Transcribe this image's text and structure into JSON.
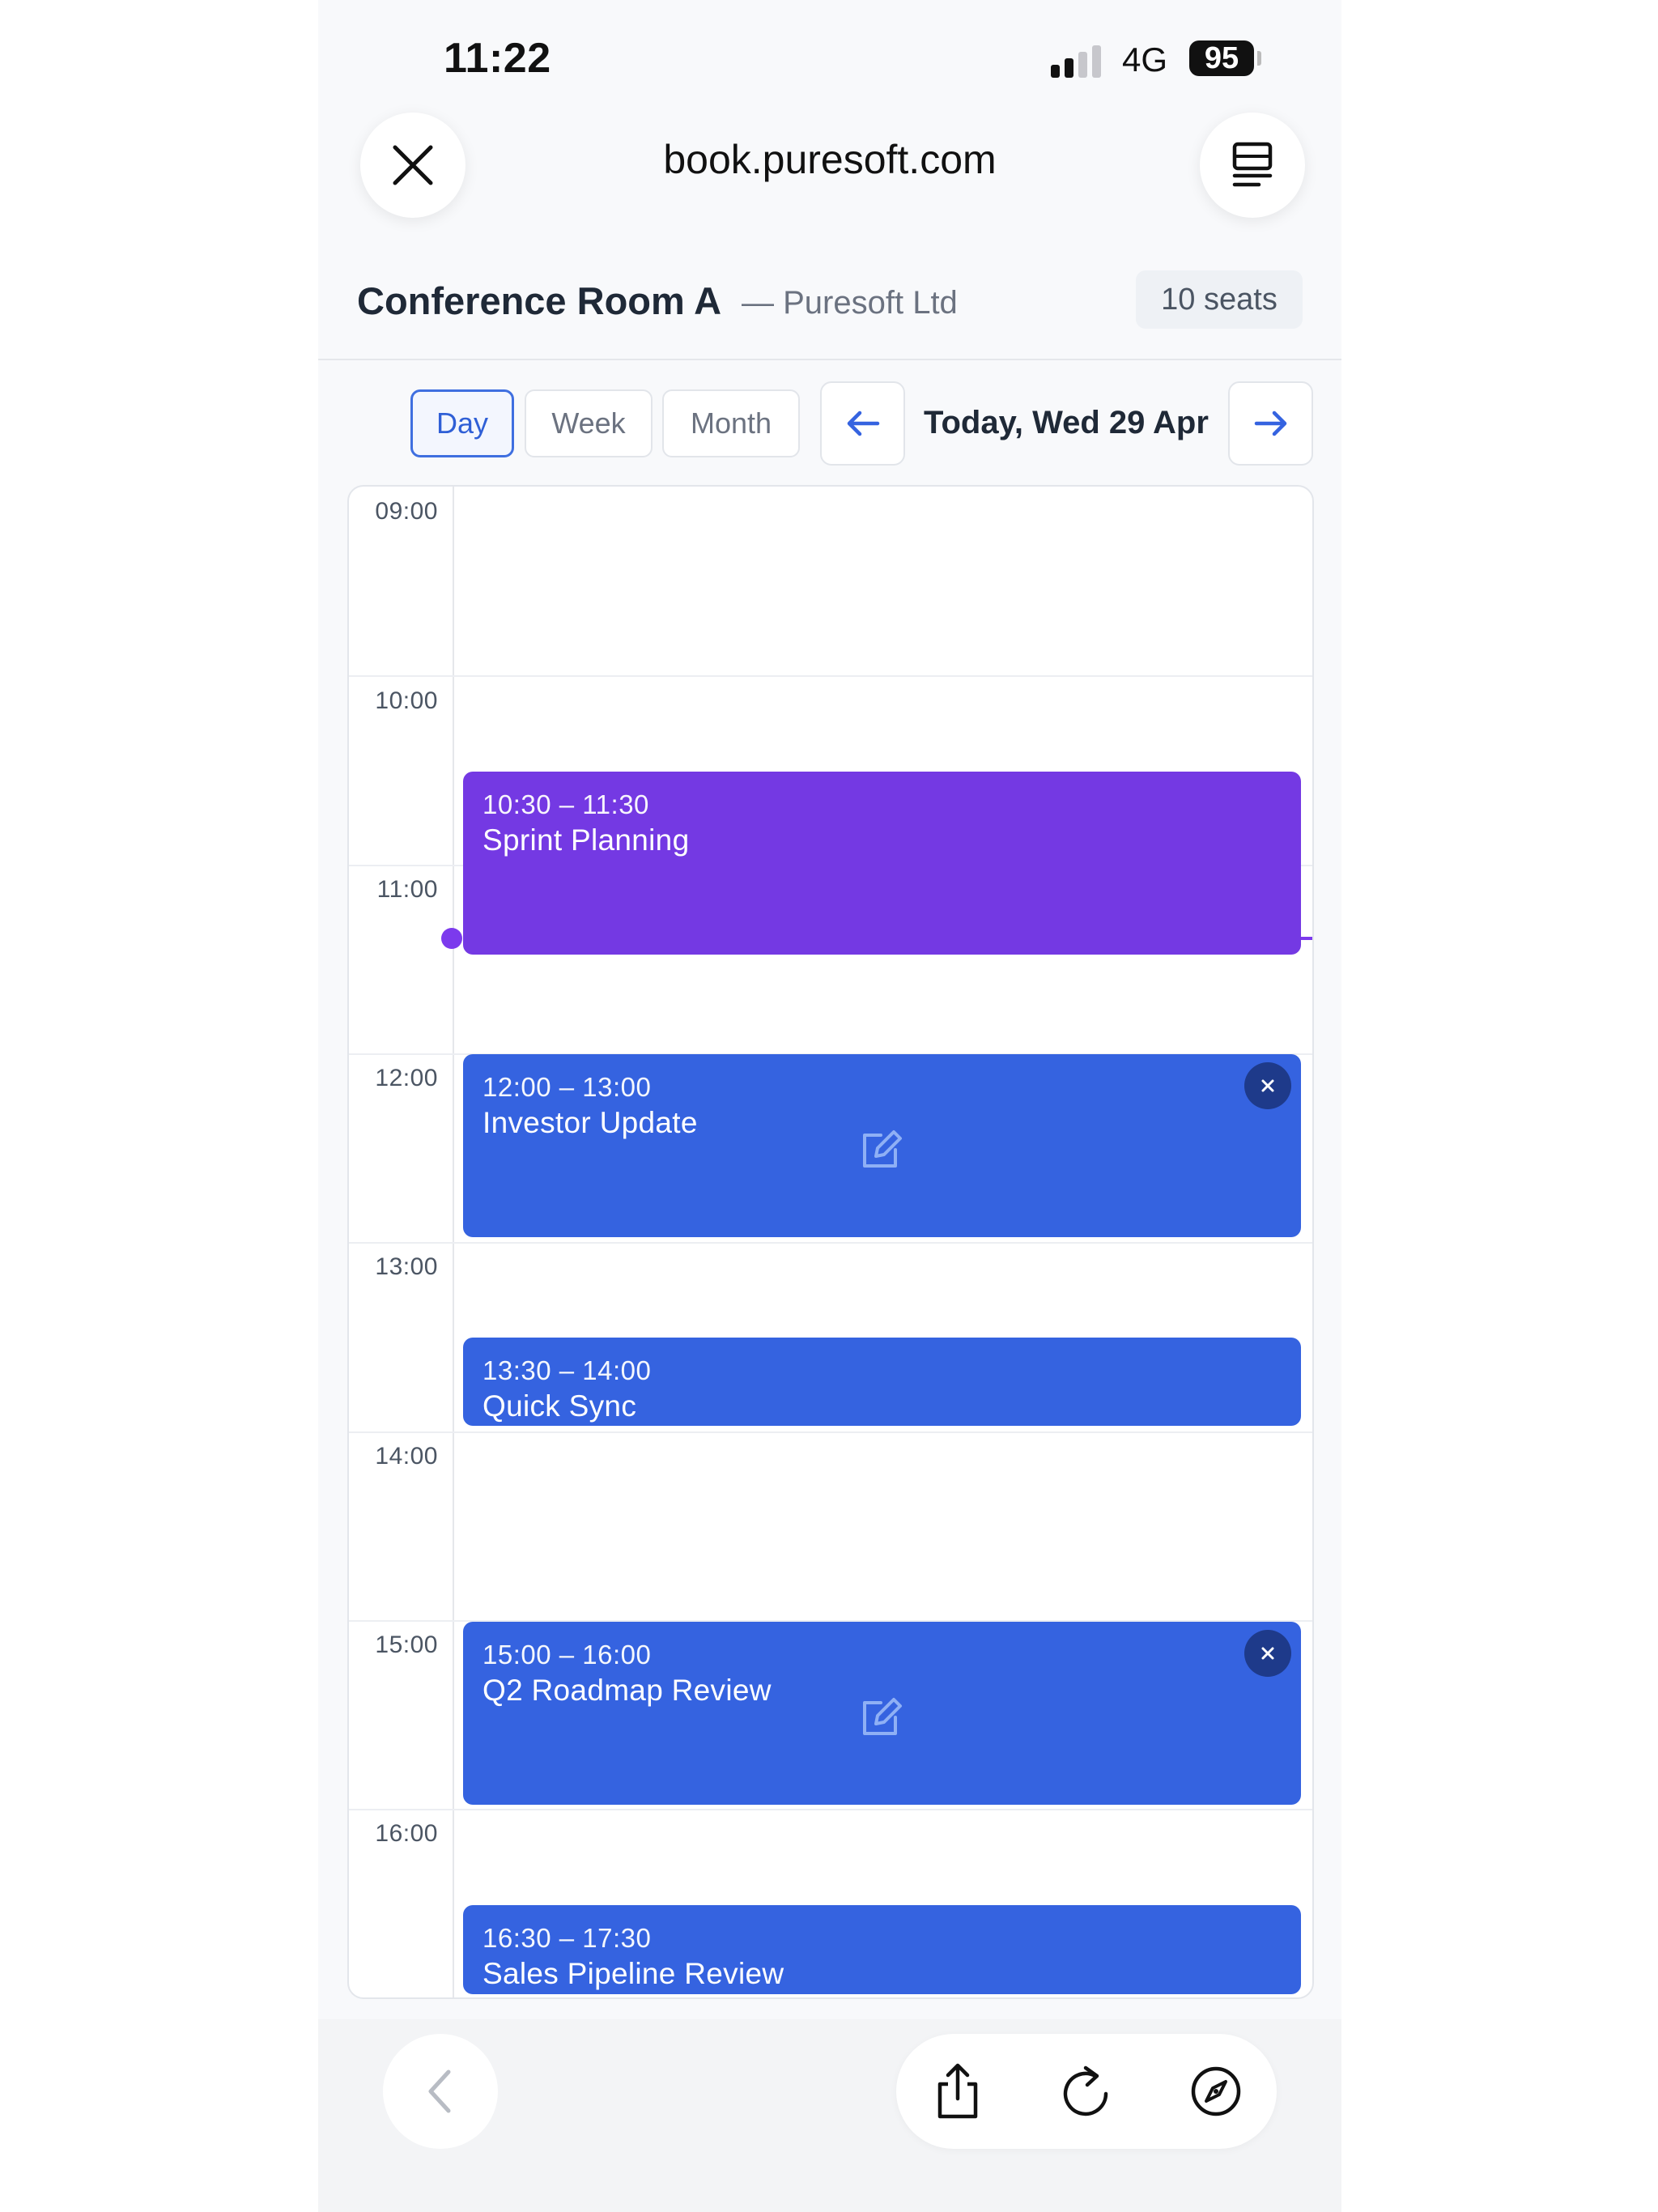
{
  "status_bar": {
    "time": "11:22",
    "network": "4G",
    "battery": "95"
  },
  "browser": {
    "url": "book.puresoft.com"
  },
  "room": {
    "name": "Conference Room A",
    "org": "— Puresoft Ltd",
    "seats": "10 seats"
  },
  "toolbar": {
    "views": [
      "Day",
      "Week",
      "Month"
    ],
    "active_view": "Day",
    "date_label": "Today, Wed 29 Apr"
  },
  "calendar": {
    "hours": [
      "09:00",
      "10:00",
      "11:00",
      "12:00",
      "13:00",
      "14:00",
      "15:00",
      "16:00"
    ],
    "now": "11:22",
    "events": [
      {
        "time": "10:30 – 11:30",
        "title": "Sprint Planning",
        "color": "#7439e3"
      },
      {
        "time": "12:00 – 13:00",
        "title": "Investor Update",
        "color": "#3563e0"
      },
      {
        "time": "13:30 – 14:00",
        "title": "Quick Sync",
        "color": "#3563e0"
      },
      {
        "time": "15:00 – 16:00",
        "title": "Q2 Roadmap Review",
        "color": "#3563e0"
      },
      {
        "time": "16:30 – 17:30",
        "title": "Sales Pipeline Review",
        "color": "#3563e0"
      }
    ]
  },
  "colors": {
    "accent": "#3563e0",
    "purple": "#7439e3",
    "close_badge": "#1e3a8a"
  },
  "icons": [
    "close-icon",
    "reader-icon",
    "arrow-left-icon",
    "arrow-right-icon",
    "edit-icon",
    "chevron-left-icon",
    "share-icon",
    "reload-icon",
    "compass-icon"
  ]
}
